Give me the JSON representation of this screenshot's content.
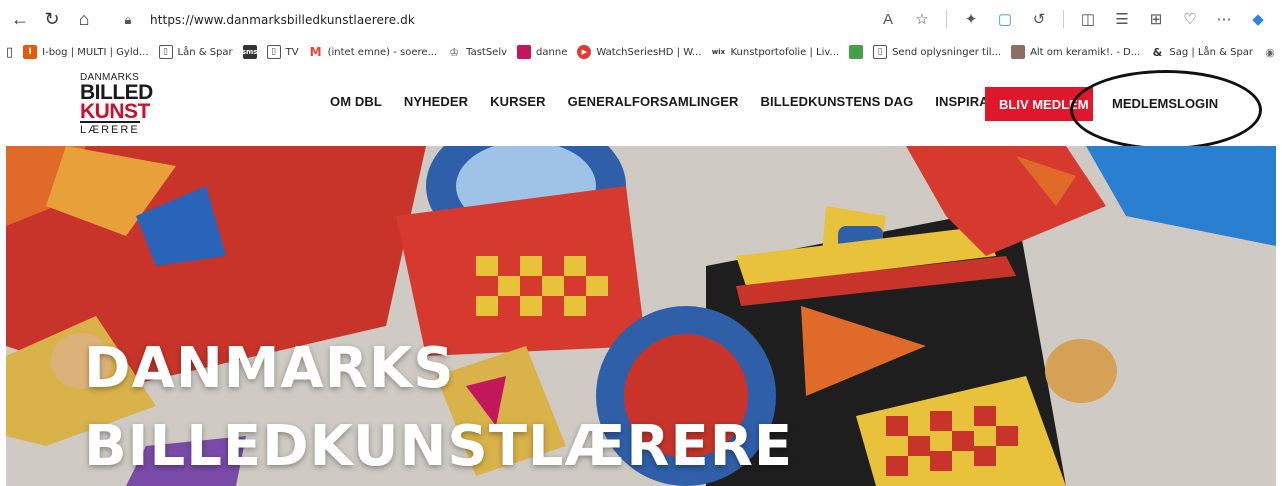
{
  "browser": {
    "url": "https://www.danmarksbilledkunstlaerere.dk",
    "icons": [
      "back-icon",
      "refresh-icon",
      "home-icon",
      "lock-icon",
      "read-aloud-icon",
      "favorite-star-icon",
      "extension-icon",
      "profile-icon",
      "refresh-2-icon",
      "split-screen-icon",
      "favorites-icon",
      "collections-icon",
      "performance-icon",
      "more-icon",
      "copilot-icon"
    ]
  },
  "favorites": [
    {
      "label": "I-bog | MULTI | Gyld...",
      "icon": "#e8590c"
    },
    {
      "label": "Lån & Spar",
      "icon": "#ffffff"
    },
    {
      "label": "",
      "icon": "#333333"
    },
    {
      "label": "TV",
      "icon": "#ffffff"
    },
    {
      "label": "(intet emne) - soere...",
      "icon": "#ea4335"
    },
    {
      "label": "TastSelv",
      "icon": "#ffffff"
    },
    {
      "label": "danne",
      "icon": "#c2185b"
    },
    {
      "label": "WatchSeriesHD | W...",
      "icon": "#e53935"
    },
    {
      "label": "Kunstportofolie | Liv...",
      "icon": "#777777"
    },
    {
      "label": "",
      "icon": "#43a047"
    },
    {
      "label": "Send oplysninger til...",
      "icon": "#ffffff"
    },
    {
      "label": "Alt om keramik!. - D...",
      "icon": "#8d6e63"
    },
    {
      "label": "Sag | Lån & Spar",
      "icon": "#ffffff"
    }
  ],
  "site": {
    "logo": {
      "line1": "DANMARKS",
      "line2": "BILLED",
      "line3": "KUNST",
      "line4": "LÆRERE"
    },
    "nav": [
      "OM DBL",
      "NYHEDER",
      "KURSER",
      "GENERALFORSAMLINGER",
      "BILLEDKUNSTENS DAG",
      "INSPIRATION"
    ],
    "cta_label": "BLIV MEDLEM",
    "login_label": "MEDLEMSLOGIN",
    "accent": "#e0162b"
  },
  "hero": {
    "line1": "DANMARKS",
    "line2": "BILLEDKUNSTLÆRERE"
  }
}
